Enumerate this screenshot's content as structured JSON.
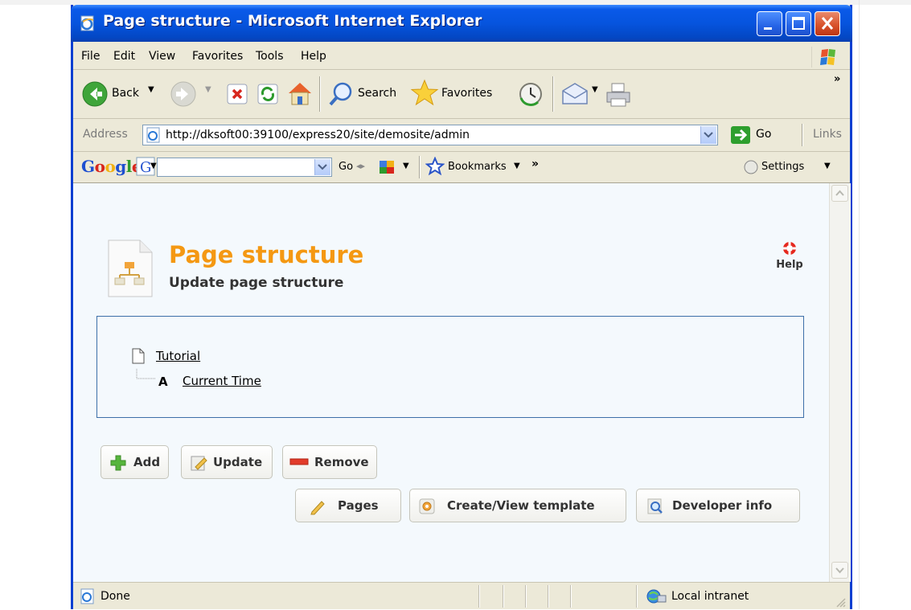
{
  "window": {
    "title": "Page structure - Microsoft Internet Explorer"
  },
  "menu": {
    "items": [
      "File",
      "Edit",
      "View",
      "Favorites",
      "Tools",
      "Help"
    ]
  },
  "toolbar": {
    "back_label": "Back",
    "search_label": "Search",
    "favorites_label": "Favorites",
    "more": "»"
  },
  "address": {
    "label": "Address",
    "url": "http://dksoft00:39100/express20/site/demosite/admin",
    "go_label": "Go",
    "links_label": "Links"
  },
  "google": {
    "logo": "Google",
    "go_label": "Go",
    "bookmarks_label": "Bookmarks",
    "more": "»",
    "settings_label": "Settings"
  },
  "page": {
    "title": "Page structure",
    "subtitle": "Update page structure",
    "help_label": "Help"
  },
  "tree": {
    "root_label": "Tutorial",
    "child_type": "A",
    "child_label": "Current Time"
  },
  "actions": {
    "add": "Add",
    "update": "Update",
    "remove": "Remove",
    "pages": "Pages",
    "create_template": "Create/View template",
    "developer_info": "Developer info"
  },
  "status": {
    "text": "Done",
    "zone": "Local intranet"
  },
  "colors": {
    "title_accent": "#f49812",
    "titlebar": "#0654de",
    "tree_border": "#3d6fa8"
  }
}
